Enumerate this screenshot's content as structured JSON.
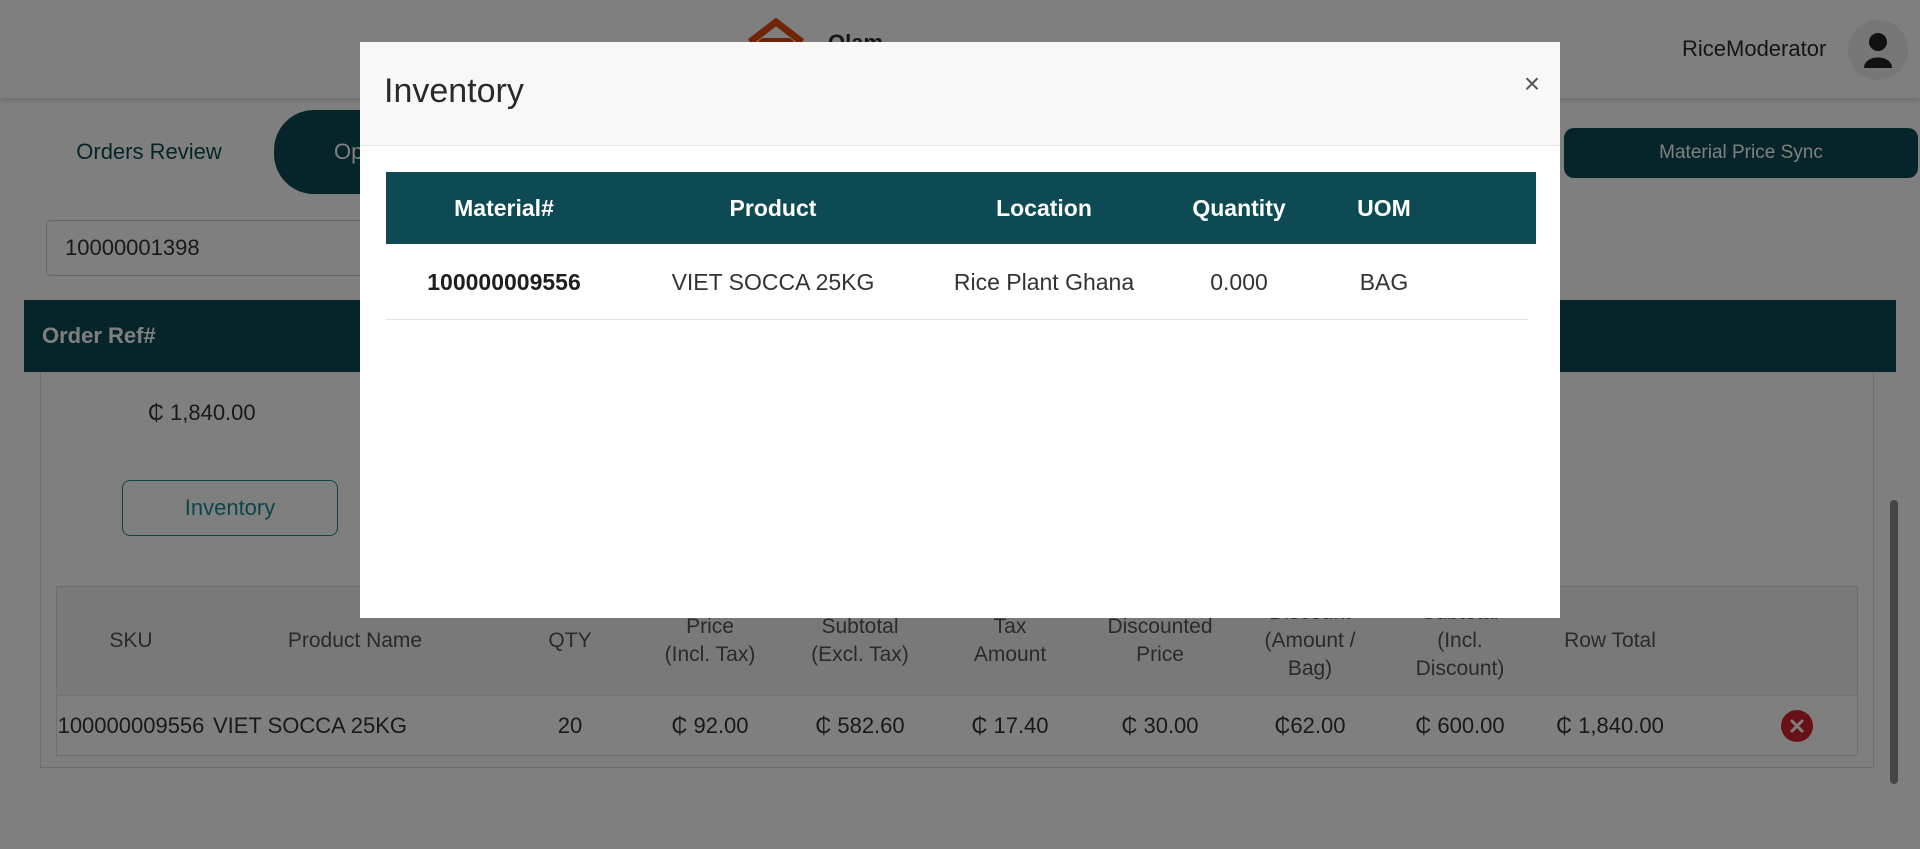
{
  "header": {
    "brand": "Olam",
    "user_name": "RiceModerator"
  },
  "tabs": {
    "active": "Orders Review",
    "second": "Op",
    "sync": "Material Price Sync"
  },
  "search": {
    "value": "10000001398"
  },
  "order": {
    "header_label": "Order Ref#",
    "total_price": "₵ 1,840.00",
    "inventory_button": "Inventory"
  },
  "items": {
    "columns": [
      {
        "l1": "SKU",
        "l2": "",
        "l3": ""
      },
      {
        "l1": "Product Name",
        "l2": "",
        "l3": ""
      },
      {
        "l1": "QTY",
        "l2": "",
        "l3": ""
      },
      {
        "l1": "Price",
        "l2": "(Incl. Tax)",
        "l3": ""
      },
      {
        "l1": "Subtotal",
        "l2": "(Excl. Tax)",
        "l3": ""
      },
      {
        "l1": "Tax",
        "l2": "Amount",
        "l3": ""
      },
      {
        "l1": "Discounted",
        "l2": "Price",
        "l3": ""
      },
      {
        "l1": "Discount",
        "l2": "(Amount /",
        "l3": "Bag)"
      },
      {
        "l1": "Subtotal",
        "l2": "(Incl.",
        "l3": "Discount)"
      },
      {
        "l1": "Row Total",
        "l2": "",
        "l3": ""
      }
    ],
    "rows": [
      {
        "sku": "100000009556",
        "product": "VIET SOCCA 25KG",
        "qty": "20",
        "price": "₵ 92.00",
        "subtotal": "₵ 582.60",
        "tax": "₵ 17.40",
        "discounted": "₵ 30.00",
        "discount_bag": "₵62.00",
        "subtotal_disc": "₵ 600.00",
        "row_total": "₵ 1,840.00"
      }
    ]
  },
  "modal": {
    "title": "Inventory",
    "close": "×",
    "columns": [
      "Material#",
      "Product",
      "Location",
      "Quantity",
      "UOM"
    ],
    "rows": [
      {
        "material": "100000009556",
        "product": "VIET SOCCA 25KG",
        "location": "Rice Plant Ghana",
        "quantity": "0.000",
        "uom": "BAG"
      }
    ]
  },
  "colors": {
    "primary": "#0d4a54",
    "accent": "#1c8a96",
    "danger": "#d0232f",
    "brand_orange": "#e04a12"
  },
  "icons": {
    "avatar": "user-icon",
    "close": "close-icon",
    "delete": "delete-circle-icon"
  }
}
